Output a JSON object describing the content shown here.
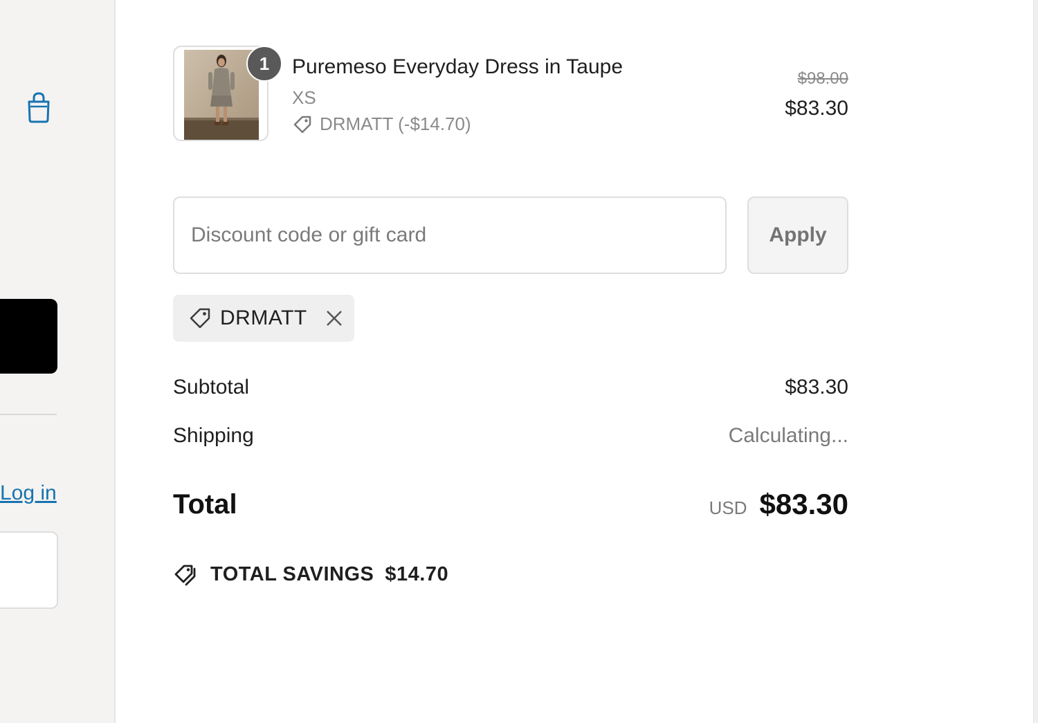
{
  "sidebar": {
    "bag_icon": "shopping-bag-icon",
    "login_label": "Log in"
  },
  "product": {
    "quantity": "1",
    "name": "Puremeso Everyday Dress in Taupe",
    "variant": "XS",
    "discount_line": "DRMATT (-$14.70)",
    "original_price": "$98.00",
    "price": "$83.30"
  },
  "discount": {
    "placeholder": "Discount code or gift card",
    "apply_label": "Apply",
    "applied_code": "DRMATT"
  },
  "summary": {
    "subtotal_label": "Subtotal",
    "subtotal_value": "$83.30",
    "shipping_label": "Shipping",
    "shipping_value": "Calculating...",
    "total_label": "Total",
    "currency": "USD",
    "total_value": "$83.30",
    "savings_label": "TOTAL SAVINGS",
    "savings_value": "$14.70"
  },
  "colors": {
    "link": "#1773b0",
    "panel_bg": "#f4f3f2",
    "text": "#1f1f1f",
    "muted": "#7a7a7a"
  }
}
